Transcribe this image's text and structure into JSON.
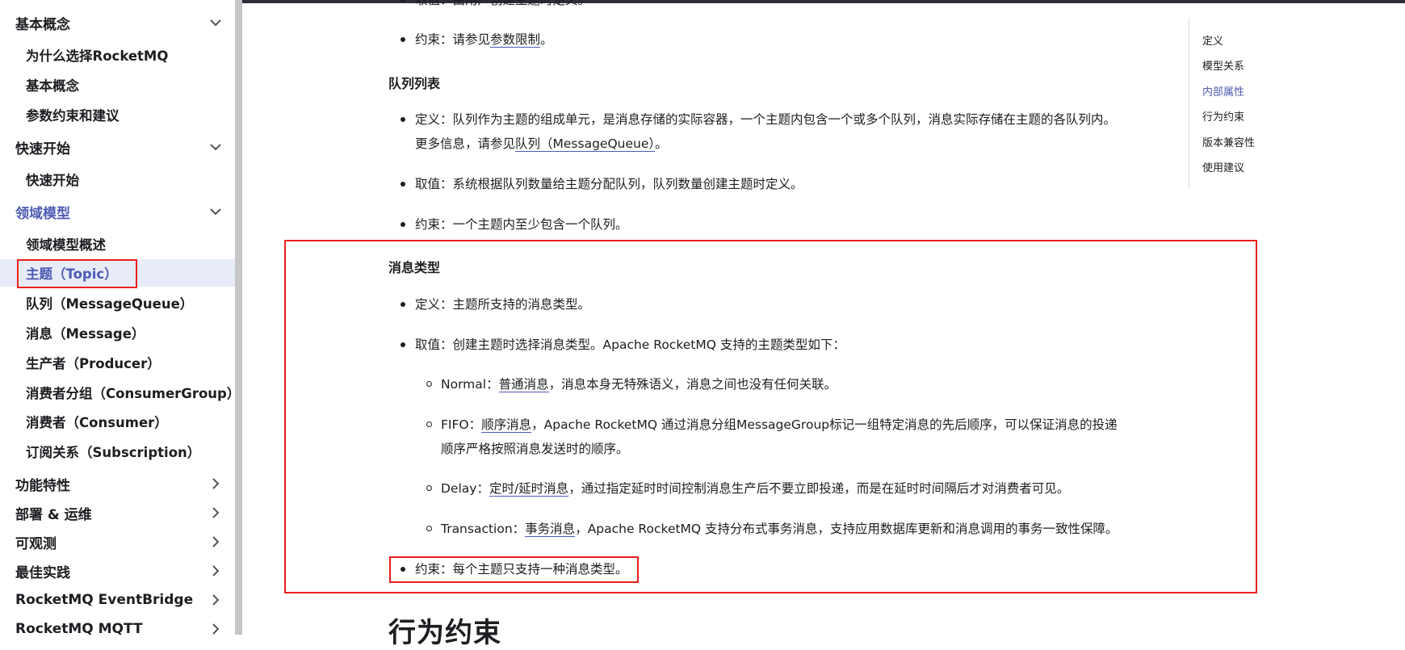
{
  "sidebar": {
    "categories": [
      {
        "label": "基本概念",
        "state": "expanded"
      },
      {
        "label": "快速开始",
        "state": "expanded"
      },
      {
        "label": "领域模型",
        "state": "expanded",
        "active": true
      },
      {
        "label": "功能特性",
        "state": "collapsed"
      },
      {
        "label": "部署 & 运维",
        "state": "collapsed"
      },
      {
        "label": "可观测",
        "state": "collapsed"
      },
      {
        "label": "最佳实践",
        "state": "collapsed"
      },
      {
        "label": "RocketMQ EventBridge",
        "state": "collapsed"
      },
      {
        "label": "RocketMQ MQTT",
        "state": "collapsed"
      }
    ],
    "basic_items": [
      "为什么选择RocketMQ",
      "基本概念",
      "参数约束和建议"
    ],
    "quickstart_items": [
      "快速开始"
    ],
    "domain_items": [
      "领域模型概述",
      "主题（Topic）",
      "队列（MessageQueue）",
      "消息（Message）",
      "生产者（Producer）",
      "消费者分组（ConsumerGroup）",
      "消费者（Consumer）",
      "订阅关系（Subscription）"
    ],
    "selected_item": "主题（Topic）"
  },
  "content": {
    "top_partial": "取值：由用户创建主题时定义。",
    "constraint_prefix": "约束：请参见",
    "constraint_link": "参数限制",
    "constraint_suffix": "。",
    "queue_heading": "队列列表",
    "queue_def_line1": "定义：队列作为主题的组成单元，是消息存储的实际容器，一个主题内包含一个或多个队列，消息实际存储在主题的各队列内。",
    "queue_def_line2_prefix": "更多信息，请参见",
    "queue_def_link": "队列（MessageQueue）",
    "queue_def_suffix": "。",
    "queue_value": "取值：系统根据队列数量给主题分配队列，队列数量创建主题时定义。",
    "queue_constraint": "约束：一个主题内至少包含一个队列。",
    "msgtype_heading": "消息类型",
    "msgtype_def": "定义：主题所支持的消息类型。",
    "msgtype_value": "取值：创建主题时选择消息类型。Apache RocketMQ 支持的主题类型如下：",
    "types": [
      {
        "prefix": "Normal：",
        "link": "普通消息",
        "suffix": "，消息本身无特殊语义，消息之间也没有任何关联。"
      },
      {
        "prefix": "FIFO：",
        "link": "顺序消息",
        "suffix": "，Apache RocketMQ 通过消息分组MessageGroup标记一组特定消息的先后顺序，可以保证消息的投递",
        "line2": "顺序严格按照消息发送时的顺序。"
      },
      {
        "prefix": "Delay：",
        "link": "定时/延时消息",
        "suffix": "，通过指定延时时间控制消息生产后不要立即投递，而是在延时时间隔后才对消费者可见。"
      },
      {
        "prefix": "Transaction：",
        "link": "事务消息",
        "suffix": "，Apache RocketMQ 支持分布式事务消息，支持应用数据库更新和消息调用的事务一致性保障。"
      }
    ],
    "msgtype_constraint": "约束：每个主题只支持一种消息类型。",
    "next_heading": "行为约束"
  },
  "toc": {
    "items": [
      "定义",
      "模型关系",
      "内部属性",
      "行为约束",
      "版本兼容性",
      "使用建议"
    ],
    "active": "内部属性"
  },
  "colors": {
    "accent": "#4e5bb4",
    "highlight_box": "#e8201c",
    "selected_bg": "#e8ebf8"
  }
}
